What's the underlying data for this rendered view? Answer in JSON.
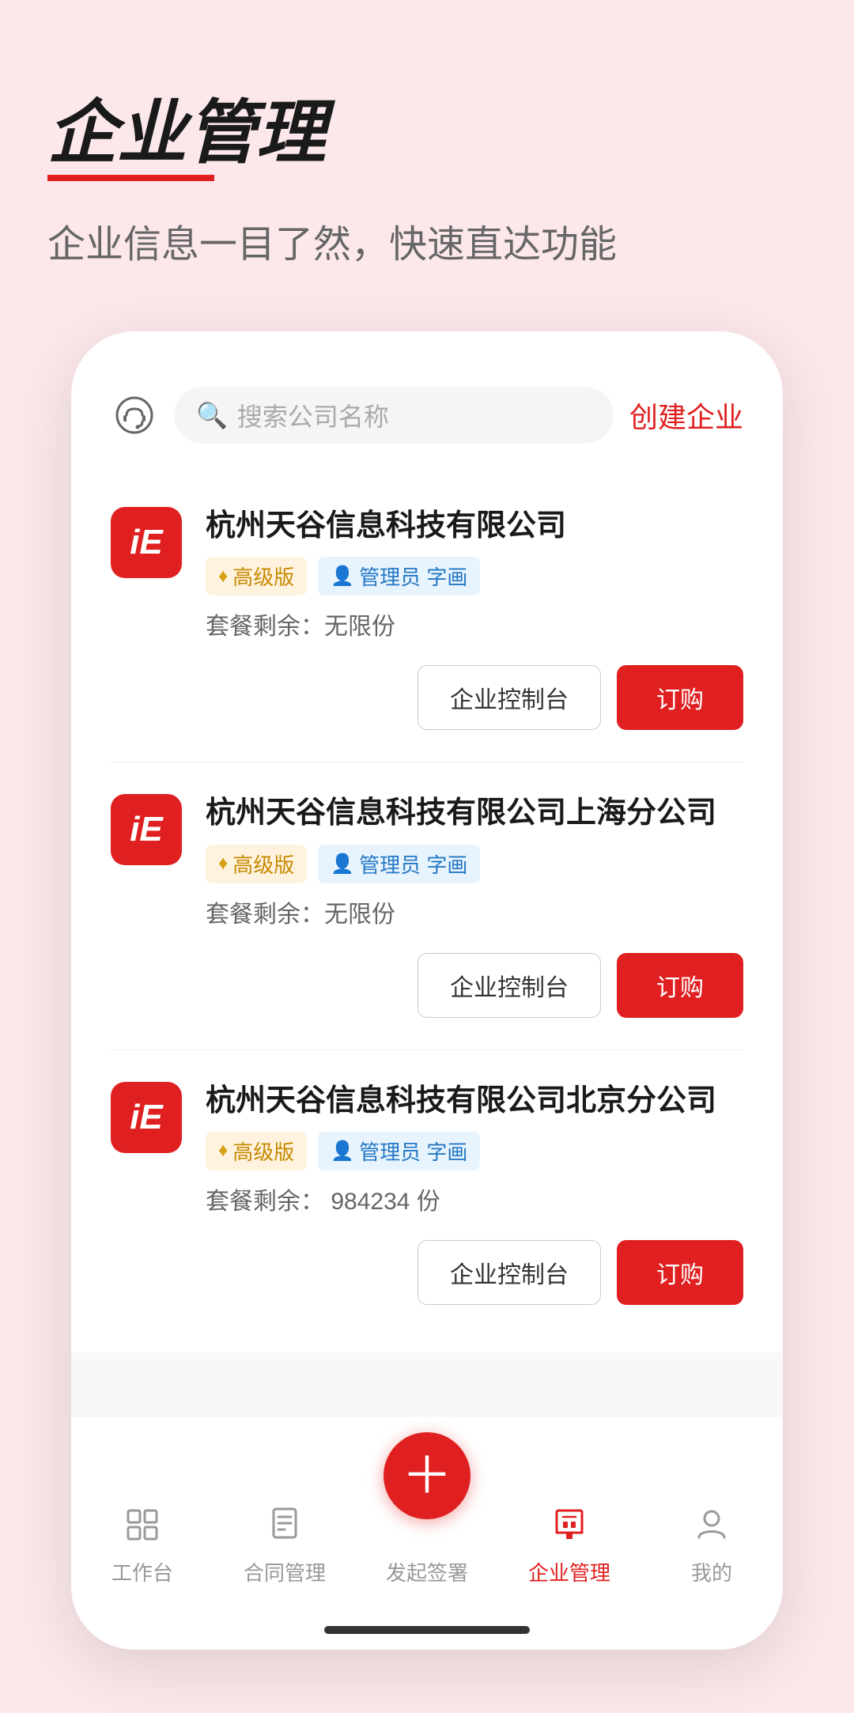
{
  "header": {
    "title": "企业管理",
    "subtitle": "企业信息一目了然，快速直达功能"
  },
  "app": {
    "search_placeholder": "搜索公司名称",
    "create_label": "创建企业"
  },
  "companies": [
    {
      "id": 1,
      "name": "杭州天谷信息科技有限公司",
      "logo_text": "iE",
      "plan": "高级版",
      "role": "管理员 字画",
      "quota_label": "套餐剩余：",
      "quota_value": "无限份",
      "btn_control": "企业控制台",
      "btn_order": "订购"
    },
    {
      "id": 2,
      "name": "杭州天谷信息科技有限公司上海分公司",
      "logo_text": "iE",
      "plan": "高级版",
      "role": "管理员 字画",
      "quota_label": "套餐剩余：",
      "quota_value": "无限份",
      "btn_control": "企业控制台",
      "btn_order": "订购"
    },
    {
      "id": 3,
      "name": "杭州天谷信息科技有限公司北京分公司",
      "logo_text": "iE",
      "plan": "高级版",
      "role": "管理员 字画",
      "quota_label": "套餐剩余：",
      "quota_value": "984234 份",
      "btn_control": "企业控制台",
      "btn_order": "订购"
    }
  ],
  "tabs": [
    {
      "id": "workbench",
      "label": "工作台",
      "icon": "workbench",
      "active": false
    },
    {
      "id": "contract",
      "label": "合同管理",
      "icon": "contract",
      "active": false
    },
    {
      "id": "sign",
      "label": "发起签署",
      "icon": "fab",
      "active": false
    },
    {
      "id": "enterprise",
      "label": "企业管理",
      "icon": "enterprise",
      "active": true
    },
    {
      "id": "mine",
      "label": "我的",
      "icon": "mine",
      "active": false
    }
  ]
}
